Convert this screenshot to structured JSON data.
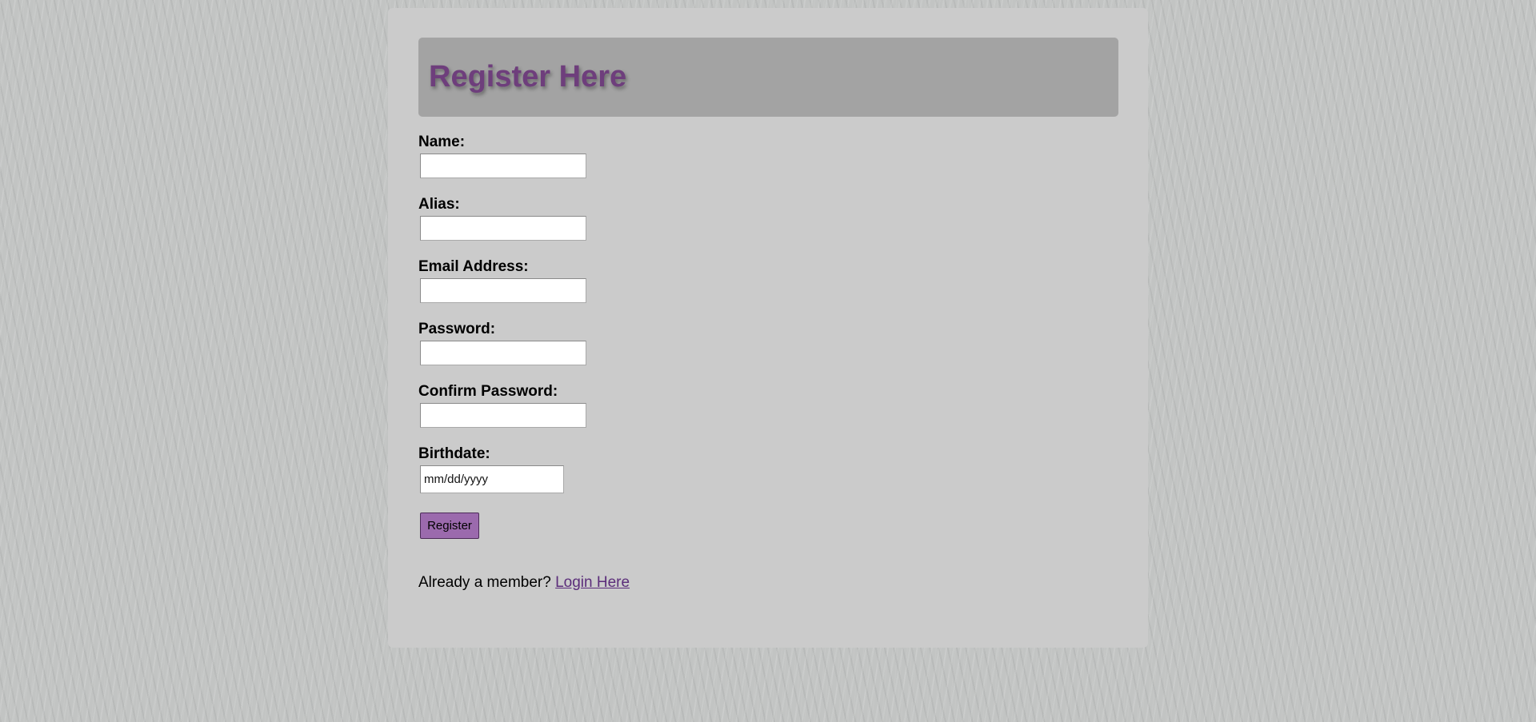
{
  "header": {
    "title": "Register Here"
  },
  "form": {
    "fields": [
      {
        "label": "Name:",
        "value": ""
      },
      {
        "label": "Alias:",
        "value": ""
      },
      {
        "label": "Email Address:",
        "value": ""
      },
      {
        "label": "Password:",
        "value": ""
      },
      {
        "label": "Confirm Password:",
        "value": ""
      },
      {
        "label": "Birthdate:",
        "placeholder": "mm/dd/yyyy"
      }
    ],
    "submit_label": "Register"
  },
  "footer": {
    "prompt": "Already a member?",
    "login_link": "Login Here"
  },
  "colors": {
    "accent": "#9b6aad",
    "title": "#6e3e7c",
    "link": "#5b2d7a"
  }
}
